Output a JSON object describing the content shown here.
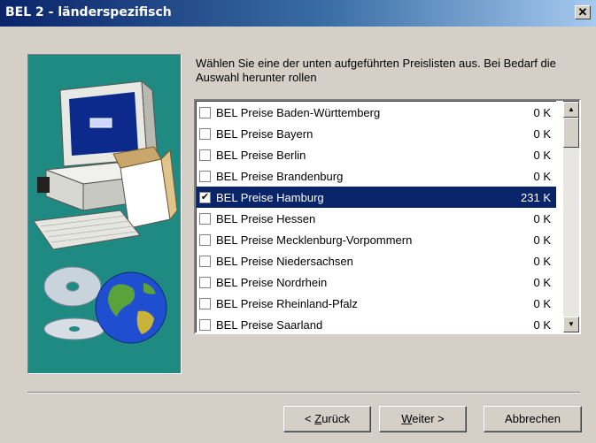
{
  "window": {
    "title": "BEL 2 - länderspezifisch",
    "close_label": "✕"
  },
  "instructions": "Wählen Sie eine der unten aufgeführten Preislisten aus. Bei Bedarf die Auswahl herunter rollen",
  "list": {
    "items": [
      {
        "label": "BEL Preise Baden-Württemberg",
        "size": "0 K",
        "checked": false
      },
      {
        "label": "BEL Preise Bayern",
        "size": "0 K",
        "checked": false
      },
      {
        "label": "BEL Preise Berlin",
        "size": "0 K",
        "checked": false
      },
      {
        "label": "BEL Preise Brandenburg",
        "size": "0 K",
        "checked": false
      },
      {
        "label": "BEL Preise Hamburg",
        "size": "231 K",
        "checked": true,
        "selected": true
      },
      {
        "label": "BEL Preise Hessen",
        "size": "0 K",
        "checked": false
      },
      {
        "label": "BEL Preise Mecklenburg-Vorpommern",
        "size": "0 K",
        "checked": false
      },
      {
        "label": "BEL Preise Niedersachsen",
        "size": "0 K",
        "checked": false
      },
      {
        "label": "BEL Preise Nordrhein",
        "size": "0 K",
        "checked": false
      },
      {
        "label": "BEL Preise Rheinland-Pfalz",
        "size": "0 K",
        "checked": false
      },
      {
        "label": "BEL Preise Saarland",
        "size": "0 K",
        "checked": false
      }
    ]
  },
  "buttons": {
    "back": {
      "prefix": "< ",
      "accel": "Z",
      "rest": "urück"
    },
    "next": {
      "accel": "W",
      "rest": "eiter",
      "suffix": " >"
    },
    "cancel": "Abbrechen"
  },
  "colors": {
    "accent": "#0a246a",
    "graphic_bg": "#1e8a82",
    "dialog_bg": "#d4d0c8"
  }
}
